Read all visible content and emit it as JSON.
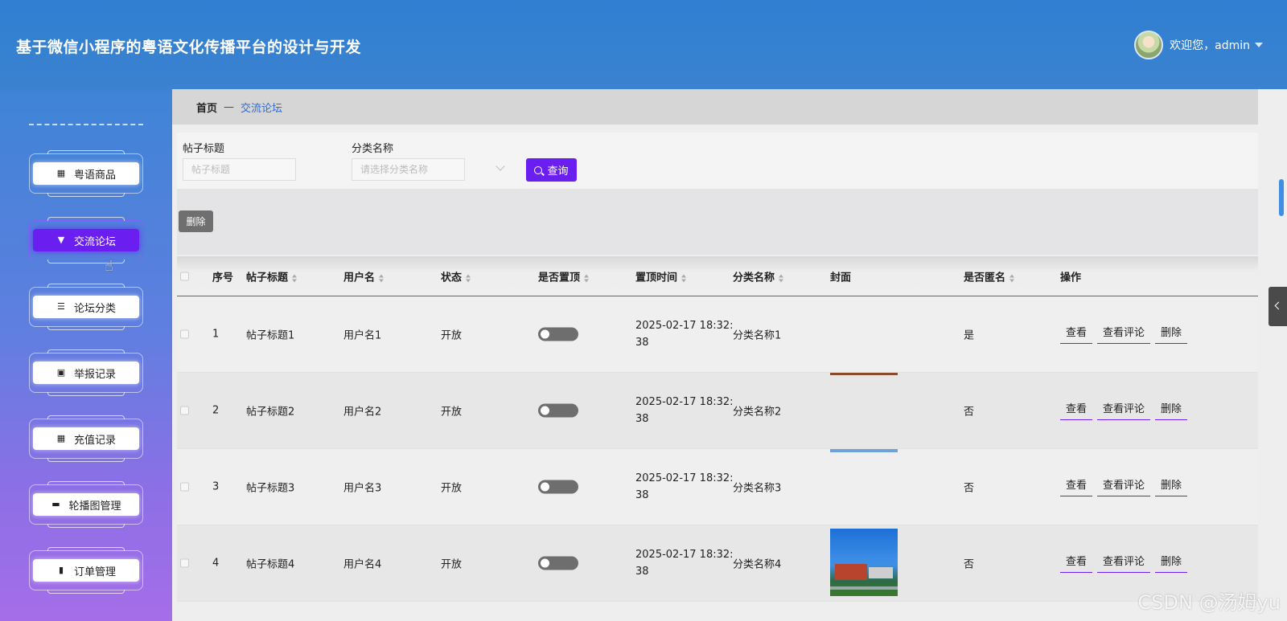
{
  "header": {
    "title": "基于微信小程序的粤语文化传播平台的设计与开发",
    "welcome": "欢迎您，admin"
  },
  "sidebar": {
    "items": [
      {
        "label": "粤语商品",
        "icon": "grid-icon"
      },
      {
        "label": "交流论坛",
        "icon": "shirt-icon",
        "active": true
      },
      {
        "label": "论坛分类",
        "icon": "list-icon"
      },
      {
        "label": "举报记录",
        "icon": "clipboard-icon"
      },
      {
        "label": "充值记录",
        "icon": "grid-icon"
      },
      {
        "label": "轮播图管理",
        "icon": "chat-icon"
      },
      {
        "label": "订单管理",
        "icon": "bar-chart-icon"
      }
    ]
  },
  "breadcrumb": {
    "home": "首页",
    "separator": "—",
    "current": "交流论坛"
  },
  "search": {
    "title_label": "帖子标题",
    "title_placeholder": "帖子标题",
    "category_label": "分类名称",
    "category_placeholder": "请选择分类名称",
    "query_button": "查询"
  },
  "actions": {
    "delete": "删除"
  },
  "table": {
    "columns": [
      "序号",
      "帖子标题",
      "用户名",
      "状态",
      "是否置顶",
      "置顶时间",
      "分类名称",
      "封面",
      "是否匿名",
      "操作"
    ],
    "rows": [
      {
        "idx": "1",
        "title": "帖子标题1",
        "user": "用户名1",
        "status": "开放",
        "time": "2025-02-17 18:32:38",
        "category": "分类名称1",
        "anonymous": "是"
      },
      {
        "idx": "2",
        "title": "帖子标题2",
        "user": "用户名2",
        "status": "开放",
        "time": "2025-02-17 18:32:38",
        "category": "分类名称2",
        "anonymous": "否"
      },
      {
        "idx": "3",
        "title": "帖子标题3",
        "user": "用户名3",
        "status": "开放",
        "time": "2025-02-17 18:32:38",
        "category": "分类名称3",
        "anonymous": "否"
      },
      {
        "idx": "4",
        "title": "帖子标题4",
        "user": "用户名4",
        "status": "开放",
        "time": "2025-02-17 18:32:38",
        "category": "分类名称4",
        "anonymous": "否"
      }
    ],
    "ops": {
      "view": "查看",
      "comments": "查看评论",
      "delete": "删除"
    }
  },
  "watermark": "CSDN @汤姆yu",
  "colors": {
    "header": "#3b82cf",
    "accent": "#6a1ff0"
  }
}
